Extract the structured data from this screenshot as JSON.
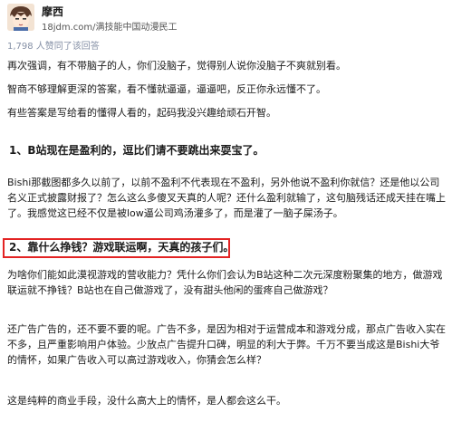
{
  "author": {
    "name": "摩西",
    "bio": "18jdm.com/满技能中国动漫民工"
  },
  "stats": {
    "agree_text": "1,798 人赞同了该回答"
  },
  "paragraphs": {
    "p1": "再次强调，有不带脑子的人，你们没脑子，觉得别人说你没脑子不爽就别看。",
    "p2": "智商不够理解更深的答案，看不懂就逼逼，逼逼吧，反正你永远懂不了。",
    "p3": "有些答案是写给看的懂得人看的，起码我没兴趣给顽石开智。",
    "h1": "1、B站现在是盈利的，逗比们请不要跳出来耍宝了。",
    "p4": "Bishi那截图都多久以前了，以前不盈利不代表现在不盈利，另外他说不盈利你就信？还是他以公司名义正式披露财报了？怎么这么多傻叉天真的人呢？还什么盈利就输了，这句脑残话还成天挂在嘴上了。我感觉这已经不仅是被low逼公司鸡汤灌多了，而是灌了一脑子屎汤子。",
    "h2": "2、靠什么挣钱？游戏联运啊，天真的孩子们。",
    "p5": "为啥你们能如此漠视游戏的营收能力？凭什么你们会认为B站这种二次元深度粉聚集的地方，做游戏联运就不挣钱？B站也在自己做游戏了，没有甜头他闲的蛋疼自己做游戏？",
    "p6": "还广告广告的，还不要不要的呢。广告不多，是因为相对于运营成本和游戏分成，那点广告收入实在不多，且严重影响用户体验。少放点广告提升口碑，明显的利大于弊。千万不要当成这是Bishi大爷的情怀，如果广告收入可以高过游戏收入，你猜会怎么样？",
    "p7": "这是纯粹的商业手段，没什么高大上的情怀，是人都会这么干。"
  },
  "colors": {
    "highlight_border": "#e32323",
    "meta_text": "#8590a6",
    "body_text": "#1a1a1a"
  },
  "icons": {
    "avatar": "anime-character-avatar"
  }
}
